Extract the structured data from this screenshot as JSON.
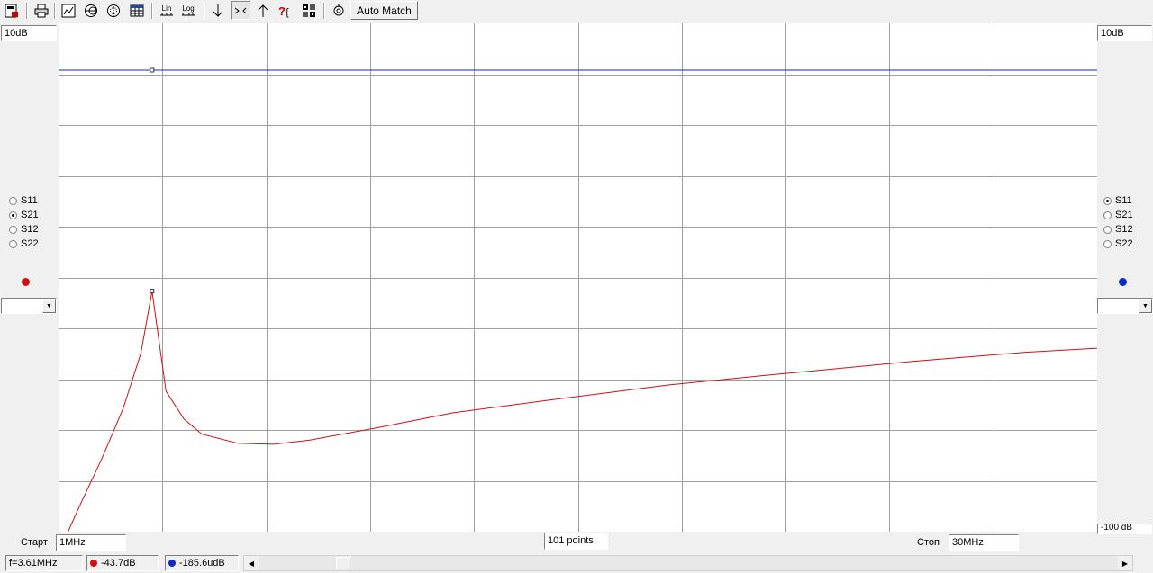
{
  "toolbar": {
    "icons": [
      "save-icon",
      "print-icon",
      "chart-view-icon",
      "smith-chart-icon",
      "polar-chart-icon",
      "table-view-icon",
      "lin-scale-icon",
      "log-scale-icon",
      "marker-down-icon",
      "zoom-in-icon",
      "marker-up-icon",
      "help-icon",
      "calibration-icon",
      "settings-icon"
    ],
    "lin_label": "Lin",
    "log_label": "Log",
    "auto_match_label": "Auto Match"
  },
  "left": {
    "scale": "10dB",
    "params": [
      "S11",
      "S21",
      "S12",
      "S22"
    ],
    "selected": "S21",
    "trace_color": "#d01010",
    "combo_value": ""
  },
  "right": {
    "scale": "10dB",
    "params": [
      "S11",
      "S21",
      "S12",
      "S22"
    ],
    "selected": "S11",
    "trace_color": "#0a2bc8",
    "combo_value": "",
    "bottom_scale": "-100 dB"
  },
  "bottom": {
    "start_label": "Старт",
    "start_value": "1MHz",
    "points": "101 points",
    "stop_label": "Стоп",
    "stop_value": "30MHz"
  },
  "status": {
    "frequency": "f=3.61MHz",
    "s21_marker": "-43.7dB",
    "s11_marker": "-185.6udB"
  },
  "chart_data": {
    "type": "line",
    "x_unit": "MHz",
    "xlim": [
      1,
      30
    ],
    "grid": true,
    "scale_per_div_db": 10,
    "series": [
      {
        "name": "S21",
        "color": "#d01010",
        "x": [
          1.0,
          1.6,
          2.2,
          2.8,
          3.3,
          3.61,
          4.0,
          4.5,
          5.0,
          6.0,
          7.0,
          8.0,
          10.0,
          12.0,
          15.0,
          18.0,
          21.0,
          25.0,
          28.0,
          30.0
        ],
        "y": [
          -95.5,
          -86.0,
          -77.0,
          -67.0,
          -56.0,
          -43.7,
          -63.5,
          -69.0,
          -72.0,
          -73.8,
          -74.0,
          -73.2,
          -70.6,
          -67.8,
          -65.0,
          -62.3,
          -60.2,
          -57.5,
          -55.8,
          -55.0
        ]
      },
      {
        "name": "S11",
        "color": "#0a2bc8",
        "x": [
          1.0,
          30.0
        ],
        "y": [
          -0.000186,
          -0.000186
        ]
      }
    ],
    "marker": {
      "x": 3.61
    }
  }
}
